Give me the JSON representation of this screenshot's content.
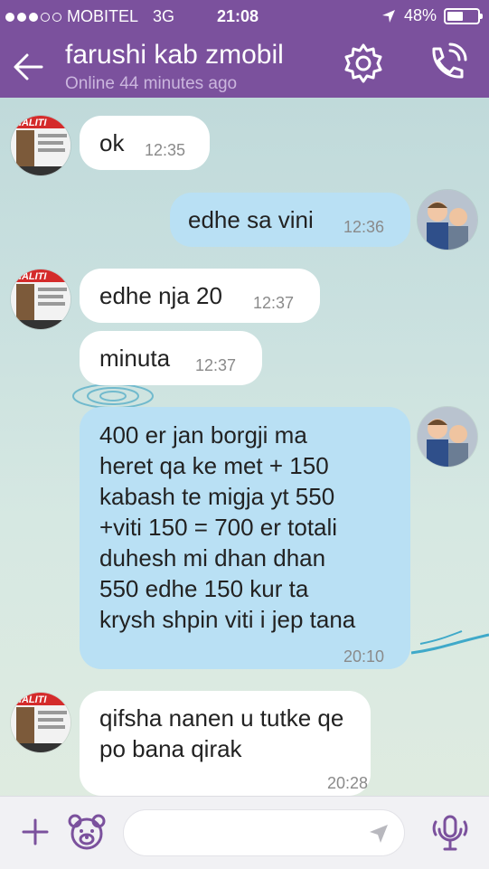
{
  "status_bar": {
    "carrier": "MOBITEL",
    "network": "3G",
    "time": "21:08",
    "battery": "48%",
    "signal_dots": [
      true,
      true,
      true,
      false,
      false
    ]
  },
  "header": {
    "title": "farushi kab zmobil",
    "subtitle": "Online 44 minutes ago",
    "color": "#7b519d",
    "icons": [
      "back-arrow-icon",
      "gear-icon",
      "phone-icon"
    ]
  },
  "avatars": {
    "shop_label": "HALITI",
    "shop_lines": [
      "Kab",
      "Mob:04"
    ]
  },
  "messages": [
    {
      "direction": "in",
      "text": "ok",
      "time": "12:35"
    },
    {
      "direction": "out",
      "text": "edhe sa vini",
      "time": "12:36"
    },
    {
      "direction": "in",
      "text": "edhe nja 20",
      "time": "12:37"
    },
    {
      "direction": "in",
      "text": "minuta",
      "time": "12:37"
    },
    {
      "direction": "out",
      "lines": [
        "400 er jan borgji  ma",
        "heret qa ke met + 150",
        "kabash te migja yt 550",
        "+viti 150 = 700 er  totali",
        "duhesh mi dhan dhan",
        "550 edhe 150 kur ta",
        "krysh shpin viti i jep tana"
      ],
      "time": "20:10"
    },
    {
      "direction": "in",
      "lines": [
        "qifsha nanen u tutke qe",
        "po bana qirak"
      ],
      "time": "20:28"
    }
  ],
  "composer": {
    "icons": [
      "plus-icon",
      "sticker-bear-icon",
      "send-arrow-icon",
      "microphone-icon"
    ],
    "placeholder": ""
  }
}
